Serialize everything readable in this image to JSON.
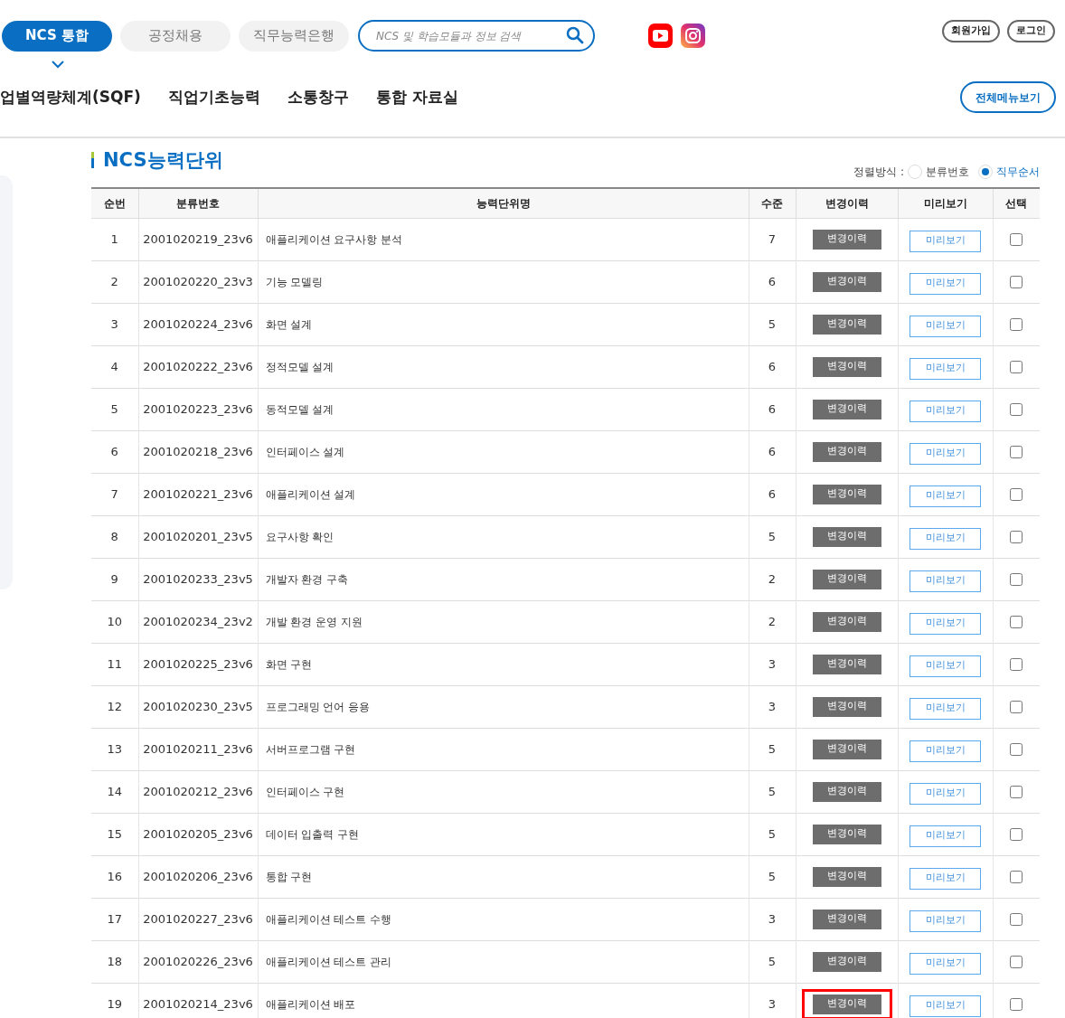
{
  "top_tabs": [
    {
      "label": "NCS 통합",
      "selected": true
    },
    {
      "label": "공정채용",
      "selected": false
    },
    {
      "label": "직무능력은행",
      "selected": false
    }
  ],
  "search": {
    "placeholder": "NCS 및 학습모듈과 정보 검색"
  },
  "account_buttons": [
    "회원가입",
    "로그인"
  ],
  "main_menu": [
    "업별역량체계(SQF)",
    "직업기초능력",
    "소통창구",
    "통합 자료실"
  ],
  "all_menu_button": "전체메뉴보기",
  "section_title": "NCS능력단위",
  "sort": {
    "label": "정렬방식 :",
    "options": [
      {
        "label": "분류번호",
        "selected": false
      },
      {
        "label": "직무순서",
        "selected": true
      }
    ]
  },
  "table": {
    "columns": [
      "순번",
      "분류번호",
      "능력단위명",
      "수준",
      "변경이력",
      "미리보기",
      "선택"
    ],
    "rows": [
      {
        "no": "1",
        "code": "2001020219_23v6",
        "name": "애플리케이션 요구사항 분석",
        "level": "7",
        "history": "변경이력",
        "preview": "미리보기",
        "checked": false,
        "highlighted": false
      },
      {
        "no": "2",
        "code": "2001020220_23v3",
        "name": "기능 모델링",
        "level": "6",
        "history": "변경이력",
        "preview": "미리보기",
        "checked": false,
        "highlighted": false
      },
      {
        "no": "3",
        "code": "2001020224_23v6",
        "name": "화면 설계",
        "level": "5",
        "history": "변경이력",
        "preview": "미리보기",
        "checked": false,
        "highlighted": false
      },
      {
        "no": "4",
        "code": "2001020222_23v6",
        "name": "정적모델 설계",
        "level": "6",
        "history": "변경이력",
        "preview": "미리보기",
        "checked": false,
        "highlighted": false
      },
      {
        "no": "5",
        "code": "2001020223_23v6",
        "name": "동적모델 설계",
        "level": "6",
        "history": "변경이력",
        "preview": "미리보기",
        "checked": false,
        "highlighted": false
      },
      {
        "no": "6",
        "code": "2001020218_23v6",
        "name": "인터페이스 설계",
        "level": "6",
        "history": "변경이력",
        "preview": "미리보기",
        "checked": false,
        "highlighted": false
      },
      {
        "no": "7",
        "code": "2001020221_23v6",
        "name": "애플리케이션 설계",
        "level": "6",
        "history": "변경이력",
        "preview": "미리보기",
        "checked": false,
        "highlighted": false
      },
      {
        "no": "8",
        "code": "2001020201_23v5",
        "name": "요구사항 확인",
        "level": "5",
        "history": "변경이력",
        "preview": "미리보기",
        "checked": false,
        "highlighted": false
      },
      {
        "no": "9",
        "code": "2001020233_23v5",
        "name": "개발자 환경 구축",
        "level": "2",
        "history": "변경이력",
        "preview": "미리보기",
        "checked": false,
        "highlighted": false
      },
      {
        "no": "10",
        "code": "2001020234_23v2",
        "name": "개발 환경 운영 지원",
        "level": "2",
        "history": "변경이력",
        "preview": "미리보기",
        "checked": false,
        "highlighted": false
      },
      {
        "no": "11",
        "code": "2001020225_23v6",
        "name": "화면 구현",
        "level": "3",
        "history": "변경이력",
        "preview": "미리보기",
        "checked": false,
        "highlighted": false
      },
      {
        "no": "12",
        "code": "2001020230_23v5",
        "name": "프로그래밍 언어 응용",
        "level": "3",
        "history": "변경이력",
        "preview": "미리보기",
        "checked": false,
        "highlighted": false
      },
      {
        "no": "13",
        "code": "2001020211_23v6",
        "name": "서버프로그램 구현",
        "level": "5",
        "history": "변경이력",
        "preview": "미리보기",
        "checked": false,
        "highlighted": false
      },
      {
        "no": "14",
        "code": "2001020212_23v6",
        "name": "인터페이스 구현",
        "level": "5",
        "history": "변경이력",
        "preview": "미리보기",
        "checked": false,
        "highlighted": false
      },
      {
        "no": "15",
        "code": "2001020205_23v6",
        "name": "데이터 입출력 구현",
        "level": "5",
        "history": "변경이력",
        "preview": "미리보기",
        "checked": false,
        "highlighted": false
      },
      {
        "no": "16",
        "code": "2001020206_23v6",
        "name": "통합 구현",
        "level": "5",
        "history": "변경이력",
        "preview": "미리보기",
        "checked": false,
        "highlighted": false
      },
      {
        "no": "17",
        "code": "2001020227_23v6",
        "name": "애플리케이션 테스트 수행",
        "level": "3",
        "history": "변경이력",
        "preview": "미리보기",
        "checked": false,
        "highlighted": false
      },
      {
        "no": "18",
        "code": "2001020226_23v6",
        "name": "애플리케이션 테스트 관리",
        "level": "5",
        "history": "변경이력",
        "preview": "미리보기",
        "checked": false,
        "highlighted": false
      },
      {
        "no": "19",
        "code": "2001020214_23v6",
        "name": "애플리케이션 배포",
        "level": "3",
        "history": "변경이력",
        "preview": "미리보기",
        "checked": false,
        "highlighted": true
      }
    ]
  }
}
